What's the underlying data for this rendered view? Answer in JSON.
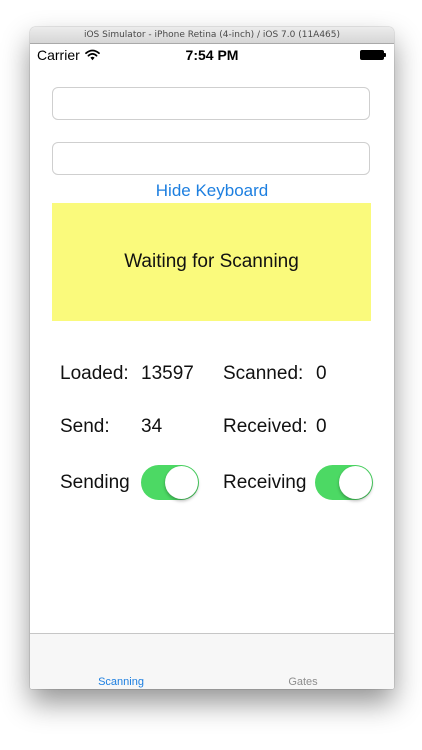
{
  "simulator": {
    "title": "iOS Simulator - iPhone Retina (4-inch) / iOS 7.0 (11A465)"
  },
  "status_bar": {
    "carrier": "Carrier",
    "time": "7:54 PM",
    "icons": [
      "wifi-icon",
      "battery-icon"
    ]
  },
  "form": {
    "field1_value": "",
    "field2_value": "",
    "hide_keyboard_label": "Hide Keyboard"
  },
  "status_panel": {
    "text": "Waiting for Scanning",
    "background": "#fafa7c"
  },
  "stats": {
    "loaded_label": "Loaded:",
    "loaded_value": "13597",
    "scanned_label": "Scanned:",
    "scanned_value": "0",
    "send_label": "Send:",
    "send_value": "34",
    "received_label": "Received:",
    "received_value": "0"
  },
  "toggles": {
    "sending_label": "Sending",
    "sending_on": true,
    "receiving_label": "Receiving",
    "receiving_on": true,
    "on_color": "#4cd964"
  },
  "tab_bar": {
    "tabs": [
      {
        "label": "Scanning",
        "active": true
      },
      {
        "label": "Gates",
        "active": false
      }
    ],
    "active_color": "#1d7fe0"
  }
}
